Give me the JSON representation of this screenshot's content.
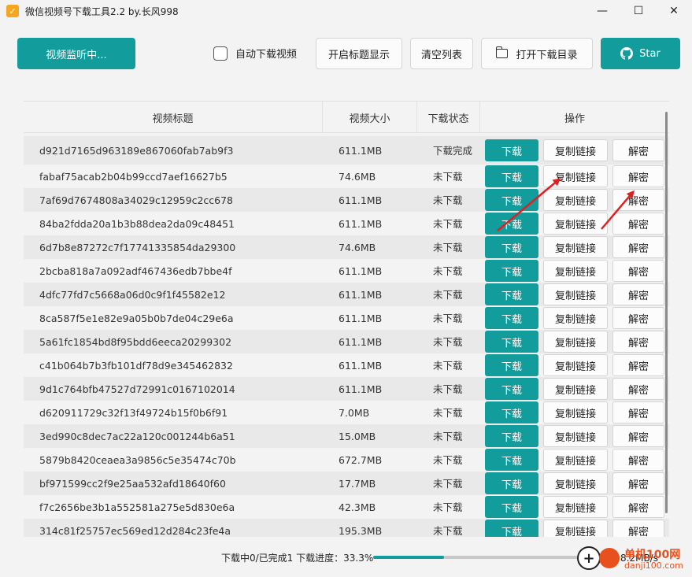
{
  "window": {
    "title": "微信视频号下载工具2.2 by.长风998",
    "minimize": "—",
    "maximize": "☐",
    "close": "✕"
  },
  "toolbar": {
    "monitor_label": "视频监听中...",
    "auto_download_label": "自动下载视频",
    "title_display_label": "开启标题显示",
    "clear_list_label": "清空列表",
    "open_dir_label": "打开下载目录",
    "star_label": "Star"
  },
  "table": {
    "headers": {
      "title": "视频标题",
      "size": "视频大小",
      "status": "下载状态",
      "ops": "操作"
    },
    "op_labels": {
      "download": "下载",
      "copy_link": "复制链接",
      "decrypt": "解密"
    },
    "rows": [
      {
        "title": "d921d7165d963189e867060fab7ab9f3",
        "size": "611.1MB",
        "status": "下载完成"
      },
      {
        "title": "fabaf75acab2b04b99ccd7aef16627b5",
        "size": "74.6MB",
        "status": "未下载"
      },
      {
        "title": "7af69d7674808a34029c12959c2cc678",
        "size": "611.1MB",
        "status": "未下载"
      },
      {
        "title": "84ba2fdda20a1b3b88dea2da09c48451",
        "size": "611.1MB",
        "status": "未下载"
      },
      {
        "title": "6d7b8e87272c7f17741335854da29300",
        "size": "74.6MB",
        "status": "未下载"
      },
      {
        "title": "2bcba818a7a092adf467436edb7bbe4f",
        "size": "611.1MB",
        "status": "未下载"
      },
      {
        "title": "4dfc77fd7c5668a06d0c9f1f45582e12",
        "size": "611.1MB",
        "status": "未下载"
      },
      {
        "title": "8ca587f5e1e82e9a05b0b7de04c29e6a",
        "size": "611.1MB",
        "status": "未下载"
      },
      {
        "title": "5a61fc1854bd8f95bdd6eeca20299302",
        "size": "611.1MB",
        "status": "未下载"
      },
      {
        "title": "c41b064b7b3fb101df78d9e345462832",
        "size": "611.1MB",
        "status": "未下载"
      },
      {
        "title": "9d1c764bfb47527d72991c0167102014",
        "size": "611.1MB",
        "status": "未下载"
      },
      {
        "title": "d620911729c32f13f49724b15f0b6f91",
        "size": "7.0MB",
        "status": "未下载"
      },
      {
        "title": "3ed990c8dec7ac22a120c001244b6a51",
        "size": "15.0MB",
        "status": "未下载"
      },
      {
        "title": "5879b8420ceaea3a9856c5e35474c70b",
        "size": "672.7MB",
        "status": "未下载"
      },
      {
        "title": "bf971599cc2f9e25aa532afd18640f60",
        "size": "17.7MB",
        "status": "未下载"
      },
      {
        "title": "f7c2656be3b1a552581a275e5d830e6a",
        "size": "42.3MB",
        "status": "未下载"
      },
      {
        "title": "314c81f25757ec569ed12d284c23fe4a",
        "size": "195.3MB",
        "status": "未下载"
      }
    ]
  },
  "status": {
    "text": "下载中0/已完成1  下载进度：33.3%",
    "progress": 0.333,
    "speed": "速度：8.2MB/s"
  },
  "watermark": {
    "name": "单机100网",
    "url": "danji100.com"
  },
  "colors": {
    "accent": "#129c9c",
    "arrow": "#e02020"
  }
}
